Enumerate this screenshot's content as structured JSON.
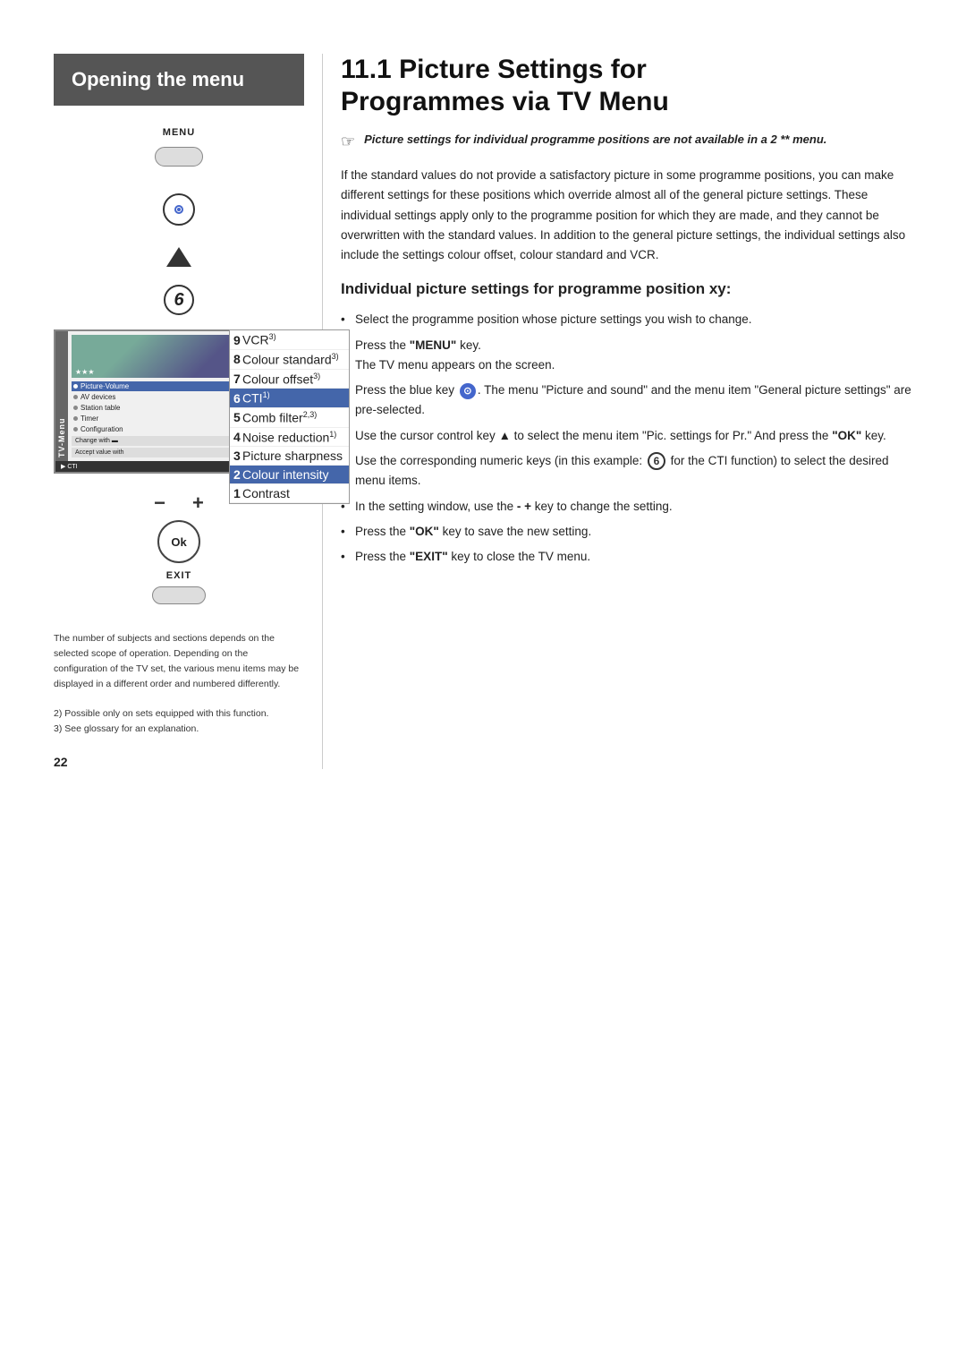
{
  "page": {
    "number": "22"
  },
  "left": {
    "opening_menu_label": "Opening the menu",
    "menu_label": "MENU",
    "ok_label": "Ok",
    "exit_label": "EXIT",
    "tv_menu": {
      "sidebar_label": "TV-Menu",
      "items": [
        {
          "label": "Picture·Volume",
          "selected": true
        },
        {
          "label": "AV devices",
          "selected": false
        },
        {
          "label": "Station table",
          "selected": false
        },
        {
          "label": "Timer",
          "selected": false
        },
        {
          "label": "Configuration",
          "selected": false
        }
      ],
      "bottom_lines": [
        "Change with",
        "Accept value with"
      ],
      "cti_bar": "CTI  Aus"
    },
    "submenu": {
      "items": [
        {
          "num": "9",
          "label": "VCR",
          "sup": "3)"
        },
        {
          "num": "8",
          "label": "Colour standard",
          "sup": "3)"
        },
        {
          "num": "7",
          "label": "Colour offset",
          "sup": "3)"
        },
        {
          "num": "6",
          "label": "CTI",
          "sup": "1)",
          "highlighted": true
        },
        {
          "num": "5",
          "label": "Comb filter",
          "sup": "2,3)"
        },
        {
          "num": "4",
          "label": "Noise reduction",
          "sup": "1)"
        },
        {
          "num": "3",
          "label": "Picture sharpness",
          "sup": ""
        },
        {
          "num": "2",
          "label": "Colour intensity",
          "sup": "",
          "highlighted": true
        },
        {
          "num": "1",
          "label": "Contrast",
          "sup": ""
        }
      ]
    }
  },
  "right": {
    "section_number": "11.1",
    "section_title_line1": "Picture Settings for",
    "section_title_line2": "Programmes via TV Menu",
    "note": {
      "icon": "☞",
      "text": "Picture settings for individual programme positions are not available in a 2 ** menu."
    },
    "body_paragraph": "If the standard values do not provide a satisfactory picture in some programme positions, you can make different settings for these positions which override almost all of the general picture settings. These individual settings apply only to the programme position for which they are made, and they cannot be overwritten with the standard values. In addition to the general picture settings, the individual settings also include the settings colour offset, colour standard and VCR.",
    "subsection_title": "Individual picture settings for programme position xy:",
    "bullets": [
      {
        "text": "Select the programme position whose picture settings you wish to change."
      },
      {
        "text": "Press the \"MENU\" key.\nThe TV menu appears on the screen."
      },
      {
        "text": "Press the blue key ⊙. The menu \"Picture and sound\" and the menu item \"General picture settings\" are pre-selected."
      },
      {
        "text": "Use the cursor control key ▲ to select the menu item \"Pic. settings for Pr.\" And press the \"OK\" key."
      },
      {
        "text": "Use the corresponding numeric keys (in this example: ❻ for the CTI function) to select the desired menu items."
      },
      {
        "text": "In the setting window, use the - + key to change the setting."
      },
      {
        "text": "Press the \"OK\" key to save the new setting."
      },
      {
        "text": "Press the \"EXIT\" key to close the TV menu."
      }
    ]
  },
  "footnotes": {
    "intro": "The number of subjects and sections depends on the selected scope of operation. Depending on the configuration of the TV set, the various menu items may be displayed in a different order and numbered differently.",
    "items": [
      "2) Possible only on sets equipped with this function.",
      "3) See glossary for an explanation."
    ]
  }
}
